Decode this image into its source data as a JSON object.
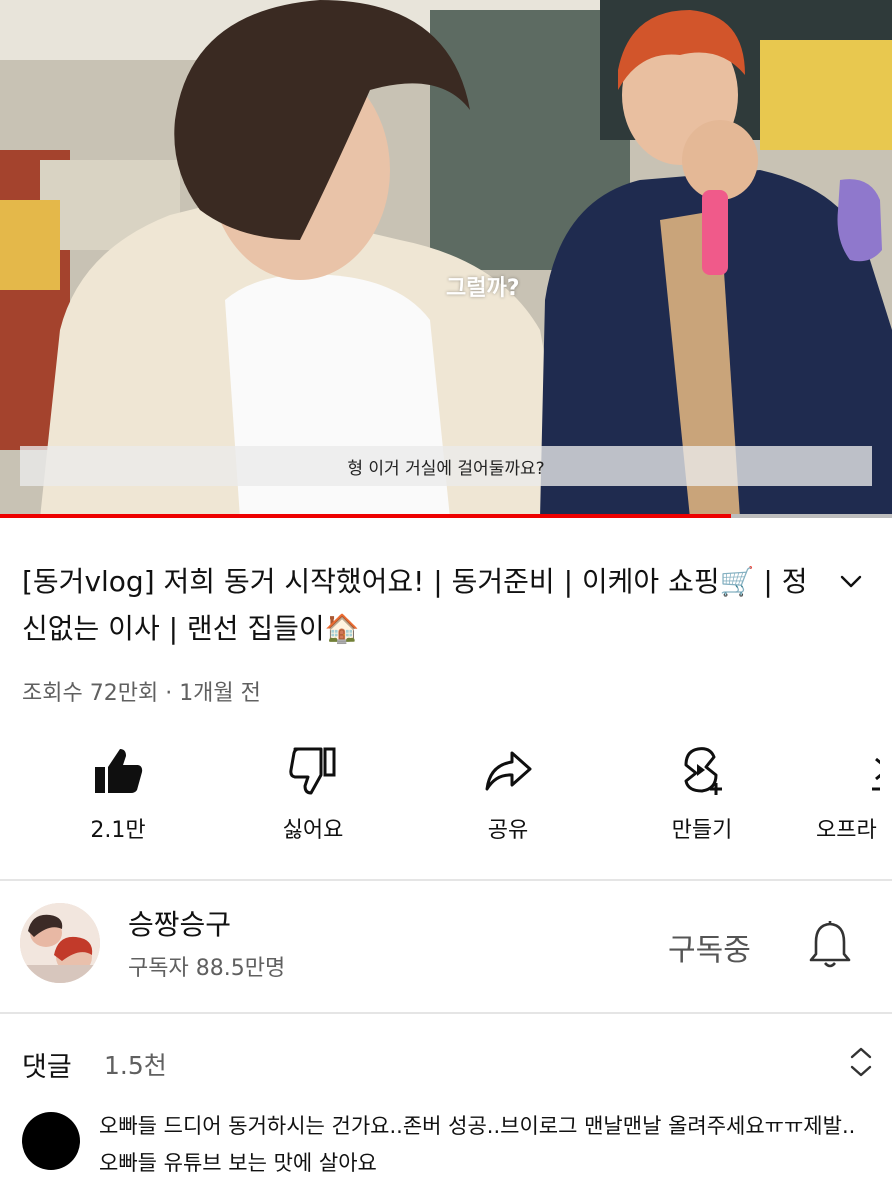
{
  "video": {
    "overlay_text": "그럴까?",
    "caption": "형 이거 거실에 걸어둘까요?",
    "progress": 0.82
  },
  "title": {
    "text": "[동거vlog] 저희 동거 시작했어요!  |  동거준비  | 이케아 쇼핑🛒 | 정신없는 이사 | 랜선 집들이🏠"
  },
  "meta": {
    "views": "조회수 72만회",
    "separator": " · ",
    "age": "1개월 전"
  },
  "actions": [
    {
      "label": "2.1만",
      "icon": "thumbs-up-icon"
    },
    {
      "label": "싫어요",
      "icon": "thumbs-down-icon"
    },
    {
      "label": "공유",
      "icon": "share-icon"
    },
    {
      "label": "만들기",
      "icon": "create-icon"
    },
    {
      "label": "오프라",
      "icon": "download-icon"
    }
  ],
  "channel": {
    "name": "승짱승구",
    "subscribers": "구독자 88.5만명",
    "subscribed_label": "구독중"
  },
  "comments": {
    "label": "댓글",
    "count": "1.5천",
    "top_comment": "오빠들 드디어 동거하시는 건가요..존버 성공..브이로그 맨날맨날 올려주세요ㅠㅠ제발..오빠들 유튜브 보는 맛에 살아요"
  },
  "colors": {
    "progress": "#ee0000",
    "secondary_text": "#606060"
  }
}
